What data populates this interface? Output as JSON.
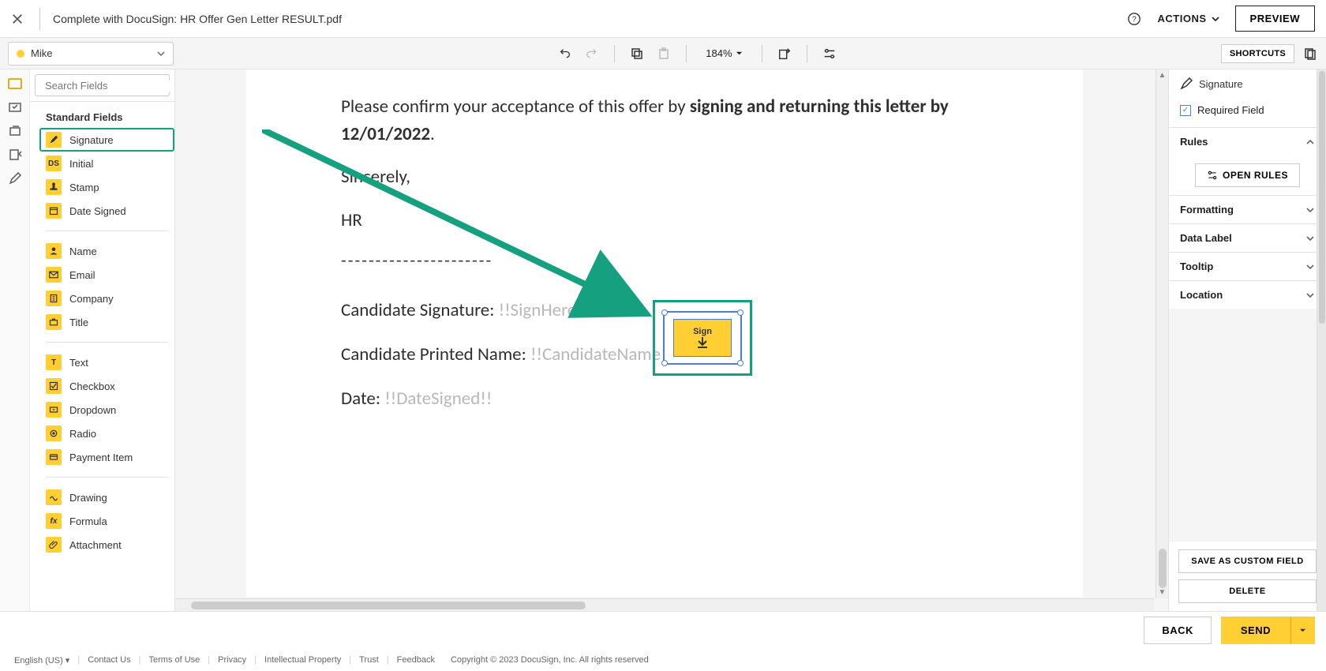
{
  "header": {
    "title": "Complete with DocuSign: HR Offer Gen Letter RESULT.pdf",
    "actions_label": "ACTIONS",
    "preview_label": "PREVIEW"
  },
  "toolbar": {
    "recipient": "Mike",
    "zoom": "184%",
    "shortcuts_label": "SHORTCUTS"
  },
  "search": {
    "placeholder": "Search Fields"
  },
  "fields": {
    "group_title": "Standard Fields",
    "items": {
      "signature": "Signature",
      "initial": "Initial",
      "stamp": "Stamp",
      "date_signed": "Date Signed",
      "name": "Name",
      "email": "Email",
      "company": "Company",
      "title": "Title",
      "text": "Text",
      "checkbox": "Checkbox",
      "dropdown": "Dropdown",
      "radio": "Radio",
      "payment_item": "Payment Item",
      "drawing": "Drawing",
      "formula": "Formula",
      "attachment": "Attachment"
    }
  },
  "document": {
    "para1_a": "Please confirm your acceptance of this offer by ",
    "para1_b": "signing and returning this letter by 12/01/2022",
    "para1_c": ".",
    "sincerely": "Sincerely,",
    "hr": "HR",
    "dashes": "----------------------",
    "sig_label": "Candidate Signature: ",
    "sig_ph": "!!SignHere!!",
    "name_label": "Candidate Printed Name: ",
    "name_ph": "!!CandidateName!!",
    "date_label": "Date: ",
    "date_ph": "!!DateSigned!!",
    "sign_box_label": "Sign"
  },
  "props": {
    "field_name": "Signature",
    "required_label": "Required Field",
    "rules": "Rules",
    "open_rules": "OPEN RULES",
    "formatting": "Formatting",
    "data_label": "Data Label",
    "tooltip": "Tooltip",
    "location": "Location",
    "save_custom": "SAVE AS CUSTOM FIELD",
    "delete": "DELETE"
  },
  "bottom": {
    "back": "BACK",
    "send": "SEND"
  },
  "footer": {
    "lang": "English (US)",
    "contact": "Contact Us",
    "terms": "Terms of Use",
    "privacy": "Privacy",
    "ip": "Intellectual Property",
    "trust": "Trust",
    "feedback": "Feedback",
    "copyright": "Copyright © 2023 DocuSign, Inc. All rights reserved"
  }
}
